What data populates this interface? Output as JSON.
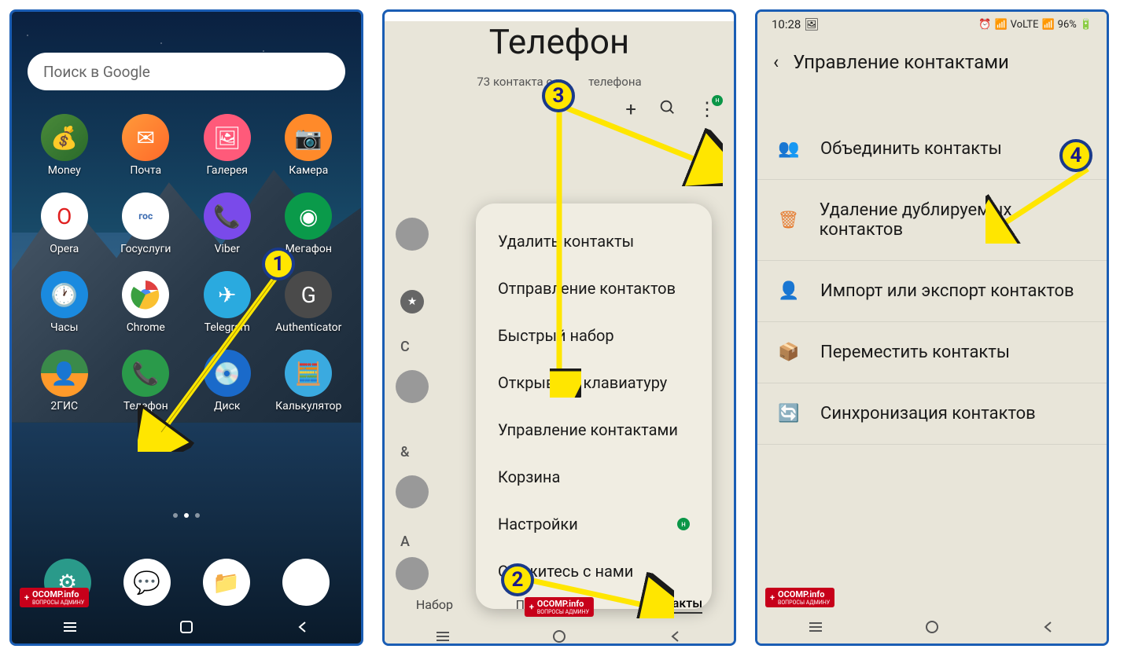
{
  "screen1": {
    "search_placeholder": "Поиск в Google",
    "apps": [
      {
        "label": "Money"
      },
      {
        "label": "Почта"
      },
      {
        "label": "Галерея"
      },
      {
        "label": "Камера"
      },
      {
        "label": "Opera"
      },
      {
        "label": "Госуслуги"
      },
      {
        "label": "Viber"
      },
      {
        "label": "Мегафон"
      },
      {
        "label": "Часы"
      },
      {
        "label": "Chrome"
      },
      {
        "label": "Telegram"
      },
      {
        "label": "Authenticator"
      },
      {
        "label": "2ГИС"
      },
      {
        "label": "Телефон"
      },
      {
        "label": "Диск"
      },
      {
        "label": "Калькулятор"
      }
    ]
  },
  "screen2": {
    "title": "Телефон",
    "subtitle_prefix": "73 контакта с н",
    "subtitle_suffix": "телефона",
    "menu": [
      "Удалить контакты",
      "Отправление контактов",
      "Быстрый набор",
      "Открывать клавиатуру",
      "Управление контактами",
      "Корзина",
      "Настройки",
      "Свяжитесь с нами"
    ],
    "letters": [
      "С",
      "&",
      "А"
    ],
    "tabs": [
      "Набор",
      "Последние",
      "Контакты"
    ],
    "badge_h": "н"
  },
  "screen3": {
    "status_time": "10:28",
    "status_battery": "96%",
    "header": "Управление контактами",
    "items": [
      "Объединить контакты",
      "Удаление дублируемых контактов",
      "Импорт или экспорт контактов",
      "Переместить контакты",
      "Синхронизация контактов"
    ]
  },
  "markers": {
    "m1": "1",
    "m2": "2",
    "m3": "3",
    "m4": "4"
  },
  "watermark": "OCOMP.info",
  "watermark_sub": "ВОПРОСЫ АДМИНУ"
}
